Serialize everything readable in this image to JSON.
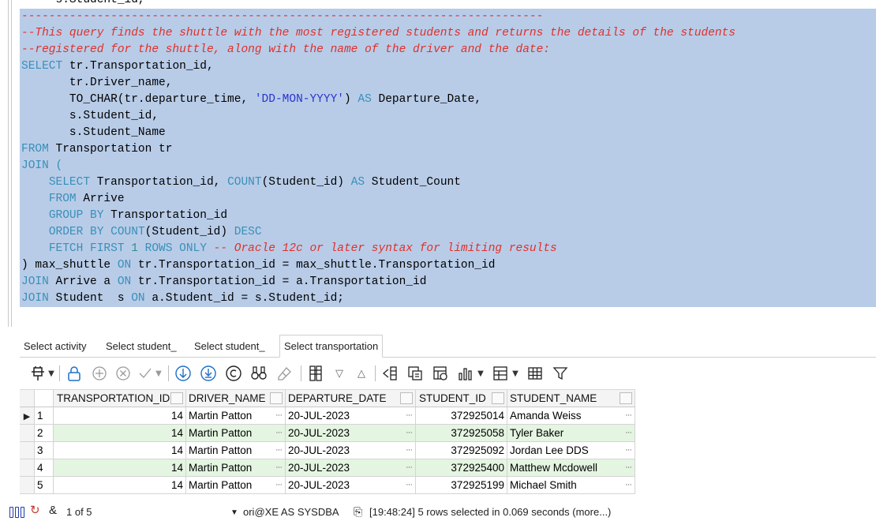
{
  "editor": {
    "partial_line": "     s.Student_id,",
    "separator": "----------------------------------------------------------------------------",
    "comment1": "--This query finds the shuttle with the most registered students and returns the details of the students",
    "comment2": "--registered for the shuttle, along with the name of the driver and the date:",
    "l_select": "SELECT",
    "l_select_rest": " tr.Transportation_id,",
    "l_driver": "       tr.Driver_name,",
    "l_tochar_pre": "       TO_CHAR(tr.departure_time, ",
    "l_tochar_str": "'DD-MON-YYYY'",
    "l_tochar_mid": ") ",
    "l_as": "AS",
    "l_tochar_post": " Departure_Date,",
    "l_sid": "       s.Student_id,",
    "l_sname": "       s.Student_Name",
    "l_from": "FROM",
    "l_from_rest": " Transportation tr",
    "l_join": "JOIN",
    "l_join_rest": " (",
    "l_sub_ind": "    ",
    "l_sub_select": "SELECT",
    "l_sub_mid": " Transportation_id, ",
    "l_count": "COUNT",
    "l_sub_count_rest": "(Student_id) ",
    "l_sub_as": "AS",
    "l_sub_post": " Student_Count",
    "l_sub_from": "FROM",
    "l_sub_from_rest": " Arrive",
    "l_groupby": "GROUP BY",
    "l_groupby_rest": " Transportation_id",
    "l_orderby": "ORDER BY",
    "l_orderby_sp": " ",
    "l_orderby_count": "COUNT",
    "l_orderby_mid": "(Student_id) ",
    "l_desc": "DESC",
    "l_fetch": "FETCH FIRST",
    "l_fetch_sp": " ",
    "l_fetch_num": "1",
    "l_fetch_rows": " ROWS ONLY",
    "l_fetch_cm": " -- Oracle 12c or later syntax for limiting results",
    "l_close_pre": ") max_shuttle ",
    "l_on": "ON",
    "l_close_post": " tr.Transportation_id = max_shuttle.Transportation_id",
    "l_join2": "JOIN",
    "l_join2_mid": " Arrive a ",
    "l_on2": "ON",
    "l_join2_post": " tr.Transportation_id = a.Transportation_id",
    "l_join3": "JOIN",
    "l_join3_mid": " Student  s ",
    "l_on3": "ON",
    "l_join3_post": " a.Student_id = s.Student_id;"
  },
  "tabs": [
    "Select activity",
    "Select student_",
    "Select student_",
    "Select transportation"
  ],
  "toolbar_icons": [
    "pin-icon",
    "lock-icon",
    "add-row-icon",
    "delete-row-icon",
    "commit-check-icon",
    "scroll-down-icon",
    "fetch-all-icon",
    "refresh-icon",
    "find-icon",
    "clear-icon",
    "column-icon",
    "sort-desc-icon",
    "sort-asc-icon",
    "split-icon",
    "copy-icon",
    "export-icon",
    "chart-icon",
    "layout-icon",
    "table-icon",
    "filter-icon"
  ],
  "grid": {
    "columns": [
      "TRANSPORTATION_ID",
      "DRIVER_NAME",
      "DEPARTURE_DATE",
      "STUDENT_ID",
      "STUDENT_NAME"
    ],
    "rows": [
      {
        "n": "1",
        "tid": "14",
        "driver": "Martin Patton",
        "date": "20-JUL-2023",
        "sid": "372925014",
        "name": "Amanda Weiss"
      },
      {
        "n": "2",
        "tid": "14",
        "driver": "Martin Patton",
        "date": "20-JUL-2023",
        "sid": "372925058",
        "name": "Tyler Baker"
      },
      {
        "n": "3",
        "tid": "14",
        "driver": "Martin Patton",
        "date": "20-JUL-2023",
        "sid": "372925092",
        "name": "Jordan Lee DDS"
      },
      {
        "n": "4",
        "tid": "14",
        "driver": "Martin Patton",
        "date": "20-JUL-2023",
        "sid": "372925400",
        "name": "Matthew Mcdowell"
      },
      {
        "n": "5",
        "tid": "14",
        "driver": "Martin Patton",
        "date": "20-JUL-2023",
        "sid": "372925199",
        "name": "Michael Smith"
      }
    ],
    "ellipsis": "···"
  },
  "status": {
    "record": "1 of 5",
    "connection": "ori@XE AS SYSDBA",
    "message": "[19:48:24]  5 rows selected in 0.069 seconds (more...)"
  },
  "colors": {
    "selection": "#b8cce8",
    "keyword": "#3a8fb8",
    "comment": "#e0302a",
    "string": "#2a34d0",
    "alt_row": "#e4f5e1"
  }
}
